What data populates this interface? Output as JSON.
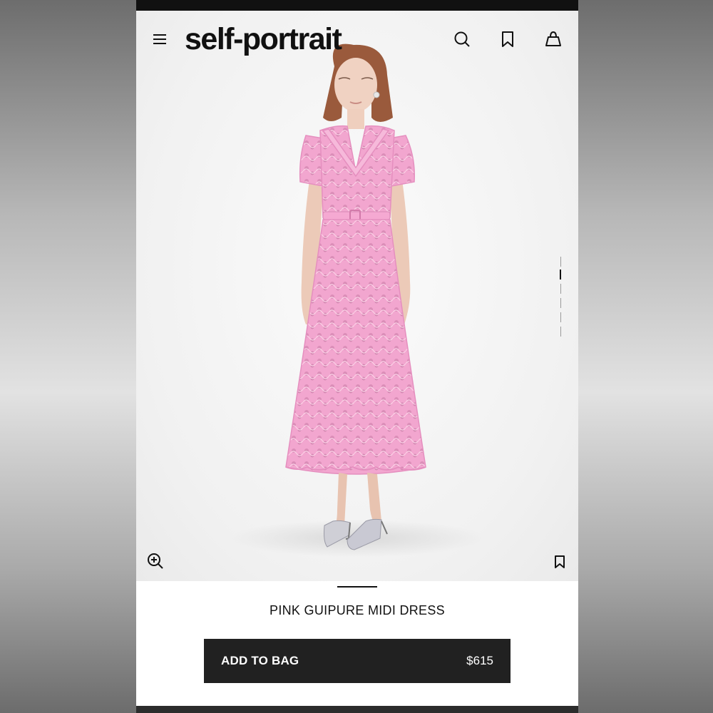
{
  "brand": {
    "logo_text": "self-portrait"
  },
  "header": {
    "icons": [
      "menu-icon",
      "search-icon",
      "bookmark-icon",
      "shopping-bag-icon"
    ]
  },
  "gallery": {
    "image_count": 5,
    "active_index": 0,
    "icons": [
      "zoom-in-icon",
      "bookmark-icon"
    ]
  },
  "product": {
    "name": "PINK GUIPURE MIDI DRESS",
    "price": "$615",
    "dress_color": "#f2a6cf"
  },
  "cta": {
    "add_to_bag_label": "ADD TO BAG"
  },
  "colors": {
    "button_bg": "#212121",
    "text": "#111111"
  }
}
